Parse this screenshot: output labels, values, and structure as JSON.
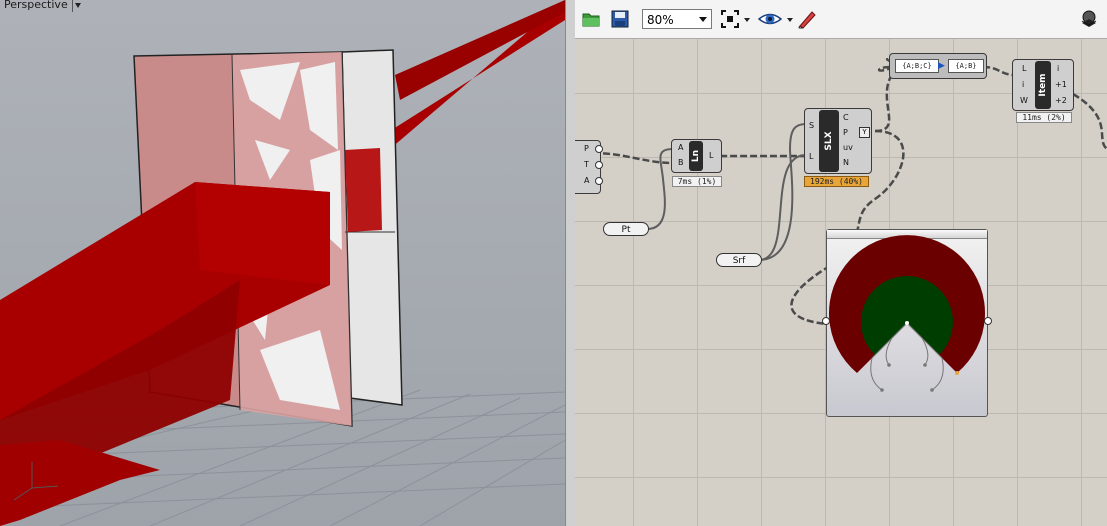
{
  "viewport": {
    "label": "Perspective",
    "menu_icon": "triangle-down-icon"
  },
  "toolbar": {
    "zoom": "80%",
    "icons": [
      "open-file-icon",
      "save-icon",
      "zoom-extents-icon",
      "preview-eye-icon",
      "sketch-pen-icon",
      "display-mode-icon"
    ]
  },
  "components": {
    "left_partial": {
      "p": "P",
      "t": "T",
      "a": "A"
    },
    "line": {
      "name": "Ln",
      "in_a": "A",
      "in_b": "B",
      "out": "L",
      "timing": "7ms (1%)"
    },
    "slx": {
      "name": "SLX",
      "in_s": "S",
      "in_l": "L",
      "out_c": "C",
      "out_p": "P",
      "out_uv": "uv",
      "out_n": "N",
      "timing": "192ms (40%)"
    },
    "item": {
      "name": "Item",
      "in_l": "L",
      "in_i": "i",
      "in_w": "W",
      "out_i": "i",
      "out_p1": "+1",
      "out_p2": "+2",
      "timing": "11ms (2%)"
    },
    "path_mapper": {
      "from": "{A;B;C}",
      "to": "{A;B}"
    },
    "pt_param": "Pt",
    "srf_param": "Srf"
  },
  "colors": {
    "ring_outer": "#6b0000",
    "ring_inner": "#003d00",
    "geometry_red": "#a80000",
    "timing_highlight": "#e8a53a"
  }
}
